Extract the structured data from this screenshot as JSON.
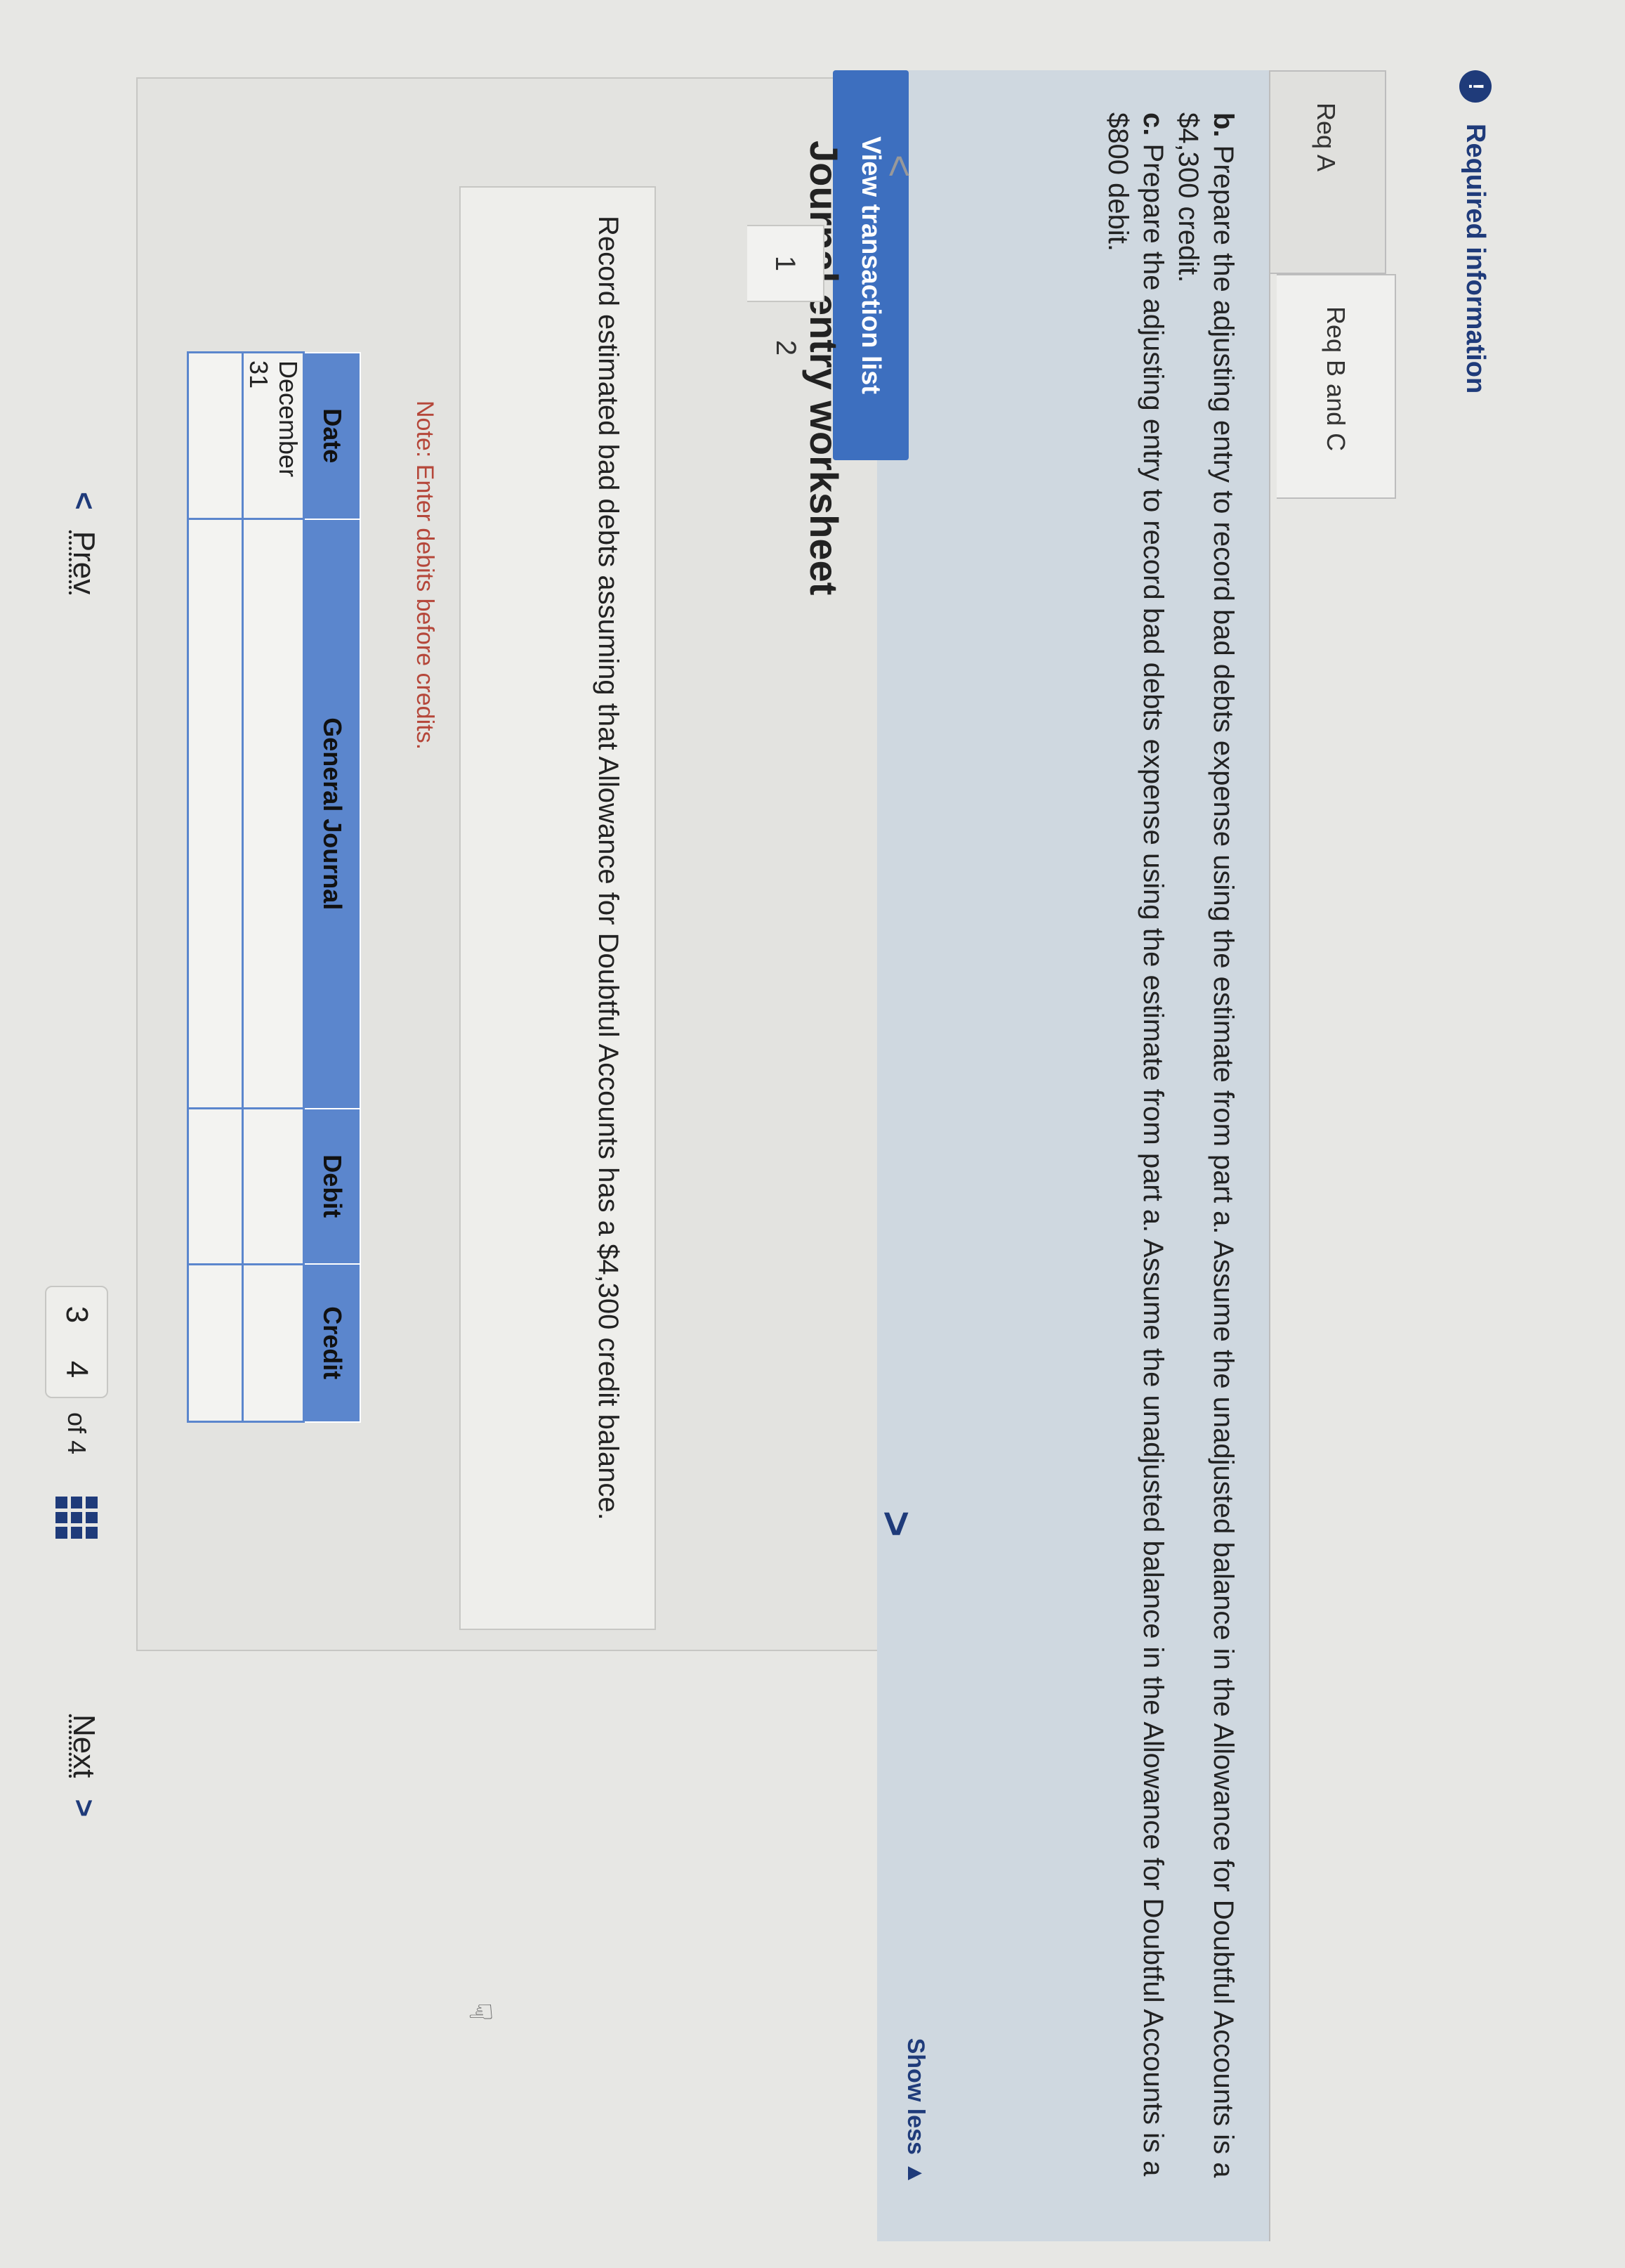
{
  "header": {
    "alert_symbol": "!",
    "title": "Required information"
  },
  "tabs": [
    {
      "label": "Req A"
    },
    {
      "label": "Req B and C"
    }
  ],
  "instructions": {
    "b_marker": "b.",
    "b_text": " Prepare the adjusting entry to record bad debts expense using the estimate from part a. Assume the unadjusted balance in the Allowance for Doubtful Accounts is a $4,300 credit.",
    "c_marker": "c.",
    "c_text": " Prepare the adjusting entry to record bad debts expense using the estimate from part a. Assume the unadjusted balance in the Allowance for Doubtful Accounts is a $800 debit.",
    "show_less": "Show less ▲"
  },
  "view_transaction_list": "View transaction list",
  "worksheet": {
    "title": "Journal entry worksheet",
    "pages": [
      "1",
      "2"
    ],
    "entry_text": "Record estimated bad debts assuming that Allowance for Doubtful Accounts has a $4,300 credit balance.",
    "note": "Note: Enter debits before credits."
  },
  "journal": {
    "headers": {
      "date": "Date",
      "account": "General Journal",
      "debit": "Debit",
      "credit": "Credit"
    },
    "rows": [
      {
        "date": "December 31",
        "account": "",
        "debit": "",
        "credit": ""
      },
      {
        "date": "",
        "account": "",
        "debit": "",
        "credit": ""
      }
    ]
  },
  "footer": {
    "prev": "Prev",
    "page_a": "3",
    "page_b": "4",
    "of_text": "of 4",
    "next": "Next"
  }
}
